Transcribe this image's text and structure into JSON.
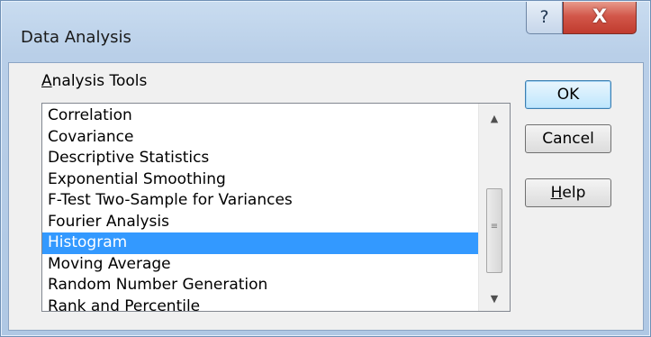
{
  "window": {
    "title": "Data Analysis",
    "help_icon": "?",
    "close_icon": "X"
  },
  "group": {
    "label": "Analysis Tools",
    "access_key": "A",
    "label_rest": "nalysis Tools"
  },
  "list": {
    "items": [
      {
        "label": "Correlation",
        "selected": false
      },
      {
        "label": "Covariance",
        "selected": false
      },
      {
        "label": "Descriptive Statistics",
        "selected": false
      },
      {
        "label": "Exponential Smoothing",
        "selected": false
      },
      {
        "label": "F-Test Two-Sample for Variances",
        "selected": false
      },
      {
        "label": "Fourier Analysis",
        "selected": false
      },
      {
        "label": "Histogram",
        "selected": true
      },
      {
        "label": "Moving Average",
        "selected": false
      },
      {
        "label": "Random Number Generation",
        "selected": false
      },
      {
        "label": "Rank and Percentile",
        "selected": false
      }
    ],
    "scroll_up_icon": "▲",
    "scroll_down_icon": "▼",
    "thumb_grip": "≡"
  },
  "buttons": {
    "ok": "OK",
    "cancel": "Cancel",
    "help_access_key": "H",
    "help_rest": "elp"
  }
}
